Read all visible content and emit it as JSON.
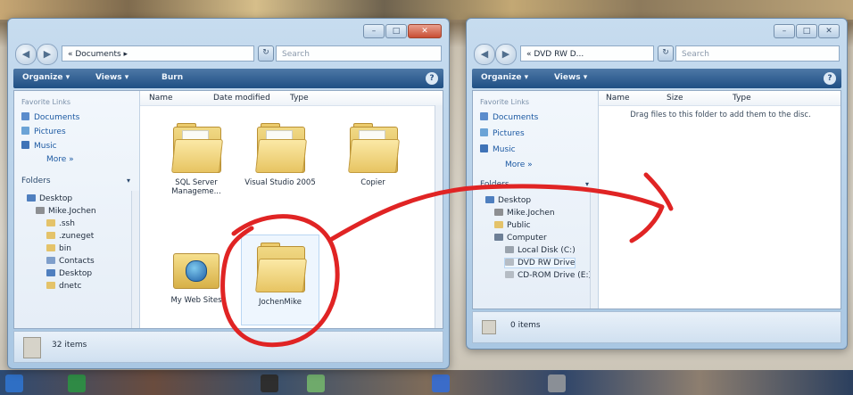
{
  "left_window": {
    "address": "« Documents ▸",
    "search_placeholder": "Search",
    "toolbar": {
      "organize": "Organize ▾",
      "views": "Views ▾",
      "burn": "Burn"
    },
    "columns": [
      "Name",
      "Date modified",
      "Type"
    ],
    "favorites_title": "Favorite Links",
    "favorites": [
      "Documents",
      "Pictures",
      "Music",
      "More »"
    ],
    "folders_title": "Folders",
    "tree": [
      "Desktop",
      "Mike.Jochen",
      ".ssh",
      ".zuneget",
      "bin",
      "Contacts",
      "Desktop",
      "dnetc"
    ],
    "items": [
      {
        "label": "SQL Server Manageme..."
      },
      {
        "label": "Visual Studio 2005"
      },
      {
        "label": "Copier"
      },
      {
        "label": "My Web Sites"
      },
      {
        "label": "JochenMike"
      }
    ],
    "status": "32 items"
  },
  "right_window": {
    "address": "« DVD RW D...",
    "search_placeholder": "Search",
    "toolbar": {
      "organize": "Organize ▾",
      "views": "Views ▾"
    },
    "columns": [
      "Name",
      "Size",
      "Type"
    ],
    "empty_message": "Drag files to this folder to add them to the disc.",
    "favorites_title": "Favorite Links",
    "favorites": [
      "Documents",
      "Pictures",
      "Music",
      "More »"
    ],
    "folders_title": "Folders",
    "tree": [
      "Desktop",
      "Mike.Jochen",
      "Public",
      "Computer",
      "Local Disk (C:)",
      "DVD RW Drive",
      "CD-ROM Drive (E:)"
    ],
    "status": "0 items"
  },
  "colors": {
    "annotation": "#e02424",
    "toolbar": "#2a5a8f",
    "folder": "#e8c96a"
  }
}
